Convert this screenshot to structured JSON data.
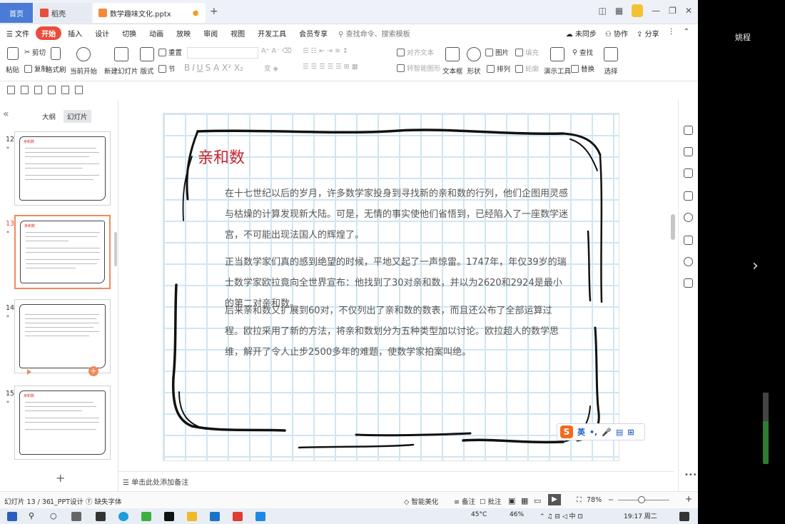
{
  "titlebar": {
    "tab_home": "首页",
    "tab_daoke": "稻壳",
    "tab_doc": "数学趣味文化.pptx"
  },
  "menubar": {
    "file": "文件",
    "items": [
      "开始",
      "插入",
      "设计",
      "切换",
      "动画",
      "放映",
      "审阅",
      "视图",
      "开发工具",
      "会员专享"
    ],
    "search": "查找命令、搜索模板",
    "sync": "未同步",
    "collab": "协作",
    "share": "分享"
  },
  "ribbon": {
    "paste": "粘贴",
    "cut": "剪切",
    "copy": "复制",
    "format_brush": "格式刷",
    "from_current": "当前开始",
    "new_slide": "新建幻灯片",
    "layout": "版式",
    "section": "节",
    "reset": "重置",
    "align_text": "对齐文本",
    "to_smartart": "转智能图形",
    "textbox": "文本框",
    "shape": "形状",
    "arrange": "排列",
    "picture": "图片",
    "fill": "填充",
    "outline": "轮廓",
    "present_tools": "演示工具",
    "find": "查找",
    "replace": "替换",
    "select": "选择"
  },
  "leftpanel": {
    "tab_outline": "大纲",
    "tab_slides": "幻灯片",
    "slides": [
      {
        "num": "12",
        "star": "*",
        "title": "亲和数"
      },
      {
        "num": "13",
        "star": "*",
        "title": "亲和数"
      },
      {
        "num": "14",
        "star": "*",
        "title": ""
      },
      {
        "num": "15",
        "star": "*",
        "title": "亲和数"
      }
    ]
  },
  "slide": {
    "title": "亲和数",
    "paragraphs": [
      "在十七世纪以后的岁月，许多数学家投身到寻找新的亲和数的行列，他们企图用灵感与枯燥的计算发现新大陆。可是，无情的事实使他们省悟到，已经陷入了一座数学迷宫，不可能出现法国人的辉煌了。",
      "正当数学家们真的感到绝望的时候，平地又起了一声惊雷。1747年，年仅39岁的瑞士数学家欧拉竟向全世界宣布：他找到了30对亲和数，并以为2620和2924是最小的第二对亲和数。",
      "后来亲和数又扩展到60对，不仅列出了亲和数的数表，而且还公布了全部运算过程。欧拉采用了新的方法，将亲和数划分为五种类型加以讨论。欧拉超人的数学思维，解开了令人止步2500多年的难题，使数学家拍案叫绝。"
    ]
  },
  "ime": {
    "lang": "英",
    "punct": "•,"
  },
  "notes": {
    "placeholder": "单击此处添加备注"
  },
  "status": {
    "slide_info": "幻灯片 13 / 36",
    "theme": "1_PPT设计",
    "missing_font": "缺失字体",
    "beautify": "智能美化",
    "comment_note": "备注",
    "comment": "批注",
    "zoom": "78%"
  },
  "taskbar": {
    "temp": "45°C",
    "cpu": "46%",
    "time": "19:17 周二"
  },
  "side": {
    "user": "姚程"
  }
}
